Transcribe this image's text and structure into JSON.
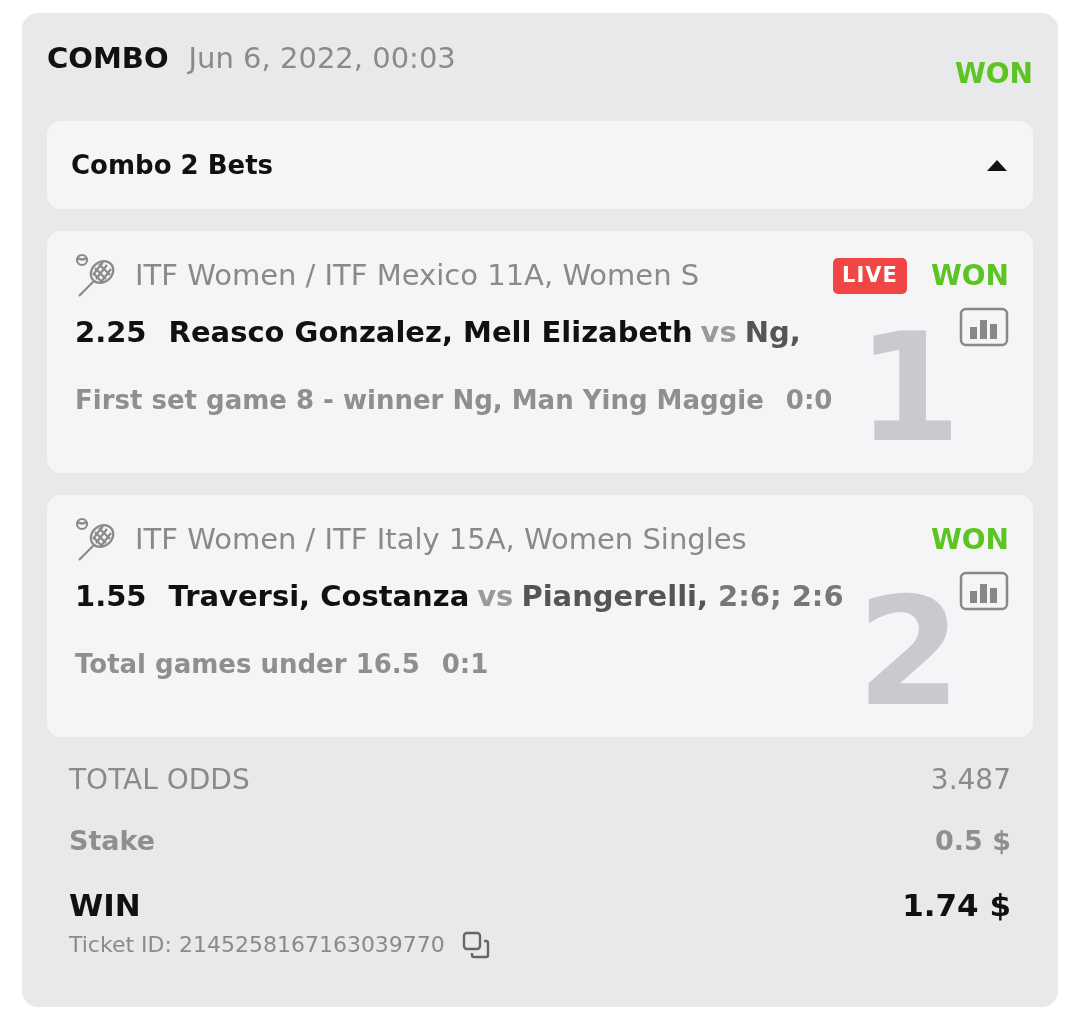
{
  "ticket": {
    "type": "COMBO",
    "date": "Jun 6, 2022, 00:03",
    "status": "WON"
  },
  "combo": {
    "label": "Combo 2 Bets",
    "expanded": true
  },
  "bets": [
    {
      "index": "1",
      "tournament": "ITF Women / ITF Mexico 11A, Women S",
      "live": true,
      "live_label": "LIVE",
      "status": "WON",
      "odds": "2.25",
      "home": "Reasco Gonzalez, Mell Elizabeth",
      "vs": "vs",
      "away": "Ng,",
      "market": "First set game 8 - winner Ng, Man Ying Maggie",
      "result": "0:0"
    },
    {
      "index": "2",
      "tournament": "ITF Women / ITF Italy 15A, Women Singles",
      "live": false,
      "status": "WON",
      "odds": "1.55",
      "home": "Traversi, Costanza",
      "vs": "vs",
      "away": "Piangerelli,",
      "score": "2:6; 2:6",
      "market": "Total games under 16.5",
      "result": "0:1"
    }
  ],
  "totals": {
    "odds_label": "TOTAL ODDS",
    "odds": "3.487",
    "stake_label": "Stake",
    "stake": "0.5 $",
    "win_label": "WIN",
    "win": "1.74 $",
    "ticket_id": "Ticket ID: 2145258167163039770"
  }
}
